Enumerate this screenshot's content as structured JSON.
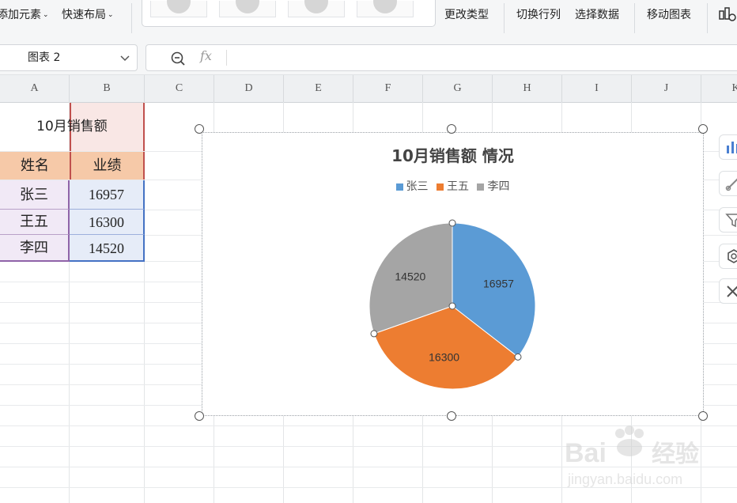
{
  "toolbar": {
    "add_element": "添加元素",
    "quick_layout": "快速布局",
    "change_type": "更改类型",
    "switch_row_col": "切换行列",
    "select_data": "选择数据",
    "move_chart": "移动图表"
  },
  "formula_bar": {
    "name_box": "图表 2",
    "fx_label": "fx",
    "formula_value": ""
  },
  "columns": [
    "A",
    "B",
    "C",
    "D",
    "E",
    "F",
    "G",
    "H",
    "I",
    "J",
    "K"
  ],
  "sheet": {
    "title": "10月销售额",
    "headers": [
      "姓名",
      "业绩"
    ],
    "rows": [
      {
        "name": "张三",
        "value": "16957"
      },
      {
        "name": "王五",
        "value": "16300"
      },
      {
        "name": "李四",
        "value": "14520"
      }
    ]
  },
  "chart_data": {
    "type": "pie",
    "title": "10月销售额 情况",
    "categories": [
      "张三",
      "王五",
      "李四"
    ],
    "values": [
      16957,
      16300,
      14520
    ],
    "colors": [
      "#5b9bd5",
      "#ed7d31",
      "#a5a5a5"
    ],
    "data_labels": [
      "16957",
      "16300",
      "14520"
    ],
    "legend_position": "top"
  }
}
